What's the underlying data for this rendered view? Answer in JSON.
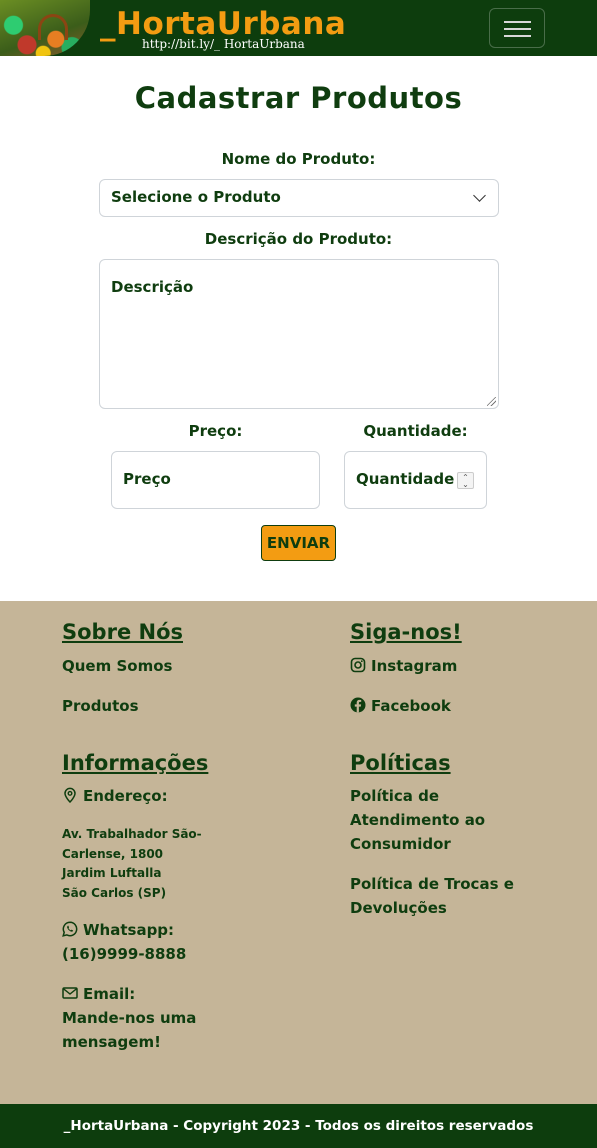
{
  "navbar": {
    "brand": "_HortaUrbana",
    "url": "http://bit.ly/_ HortaUrbana",
    "menu_icon": "hamburger-icon"
  },
  "form": {
    "title": "Cadastrar Produtos",
    "product_name_label": "Nome do Produto:",
    "product_select_value": "Selecione o Produto",
    "description_label": "Descrição do Produto:",
    "description_placeholder": "Descrição",
    "price_label": "Preço:",
    "price_placeholder": "Preço",
    "quantity_label": "Quantidade:",
    "quantity_placeholder": "Quantidade",
    "submit_label": "ENVIAR"
  },
  "footer": {
    "about": {
      "heading": "Sobre Nós",
      "links": [
        "Quem Somos",
        "Produtos"
      ]
    },
    "follow": {
      "heading": "Siga-nos!",
      "instagram": "Instagram",
      "facebook": "Facebook"
    },
    "info": {
      "heading": "Informações",
      "address_label": "Endereço:",
      "address_lines": [
        "Av. Trabalhador São-",
        "Carlense, 1800",
        "Jardim Luftalla",
        "São Carlos (SP)"
      ],
      "whatsapp_label": "Whatsapp:",
      "whatsapp_number": "(16)9999-8888",
      "email_label": "Email:",
      "email_text_1": "Mande-nos uma",
      "email_text_2": "mensagem!"
    },
    "policies": {
      "heading": "Políticas",
      "service_1": "Política de",
      "service_2": "Atendimento ao",
      "service_3": "Consumidor",
      "exchange_1": "Política de Trocas e",
      "exchange_2": "Devoluções"
    },
    "copyright": "_HortaUrbana - Copyright 2023 - Todos os direitos reservados"
  },
  "colors": {
    "navbar_bg": "#0d3d0d",
    "brand_orange": "#f39c12",
    "text_green": "#0f3d0f",
    "footer_bg": "#c5b598"
  }
}
